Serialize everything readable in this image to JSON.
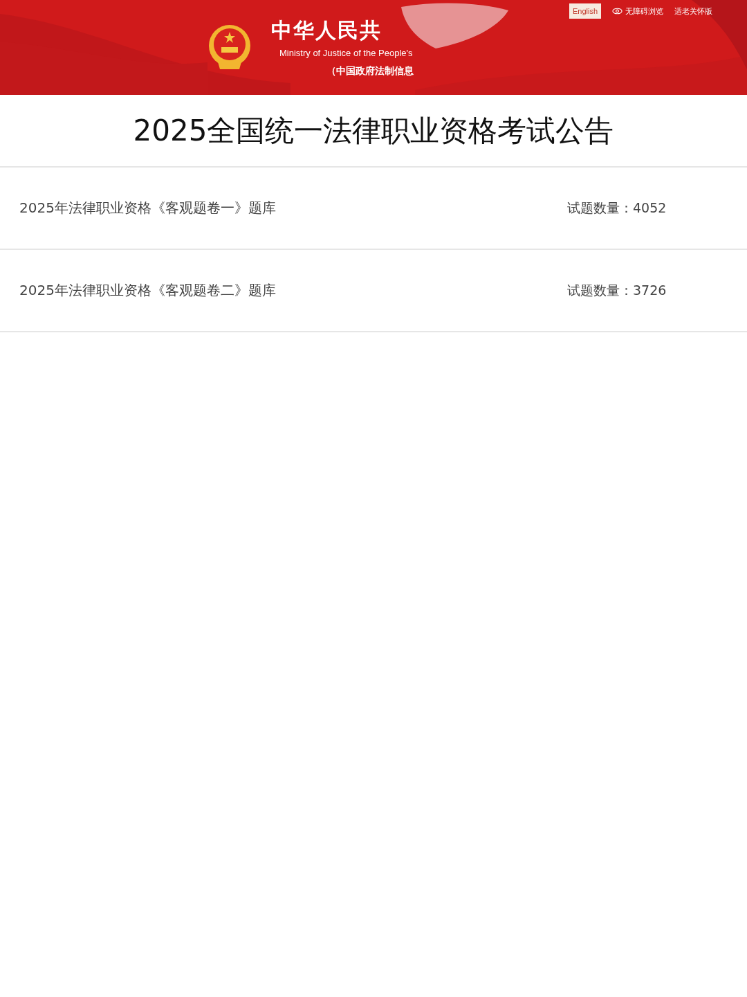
{
  "header": {
    "title": "中华人民共",
    "subtitle": "Ministry of Justice of the People's",
    "note": "（中国政府法制信息",
    "links": [
      {
        "kind": "button",
        "label": "English"
      },
      {
        "kind": "eye",
        "label": "无障碍浏览"
      },
      {
        "kind": "plain",
        "label": "适老关怀版"
      }
    ]
  },
  "page_title": "2025全国统一法律职业资格考试公告",
  "items": [
    {
      "name": "2025年法律职业资格《客观题卷一》题库",
      "count": "试题数量：4052"
    },
    {
      "name": "2025年法律职业资格《客观题卷二》题库",
      "count": "试题数量：3726"
    }
  ]
}
